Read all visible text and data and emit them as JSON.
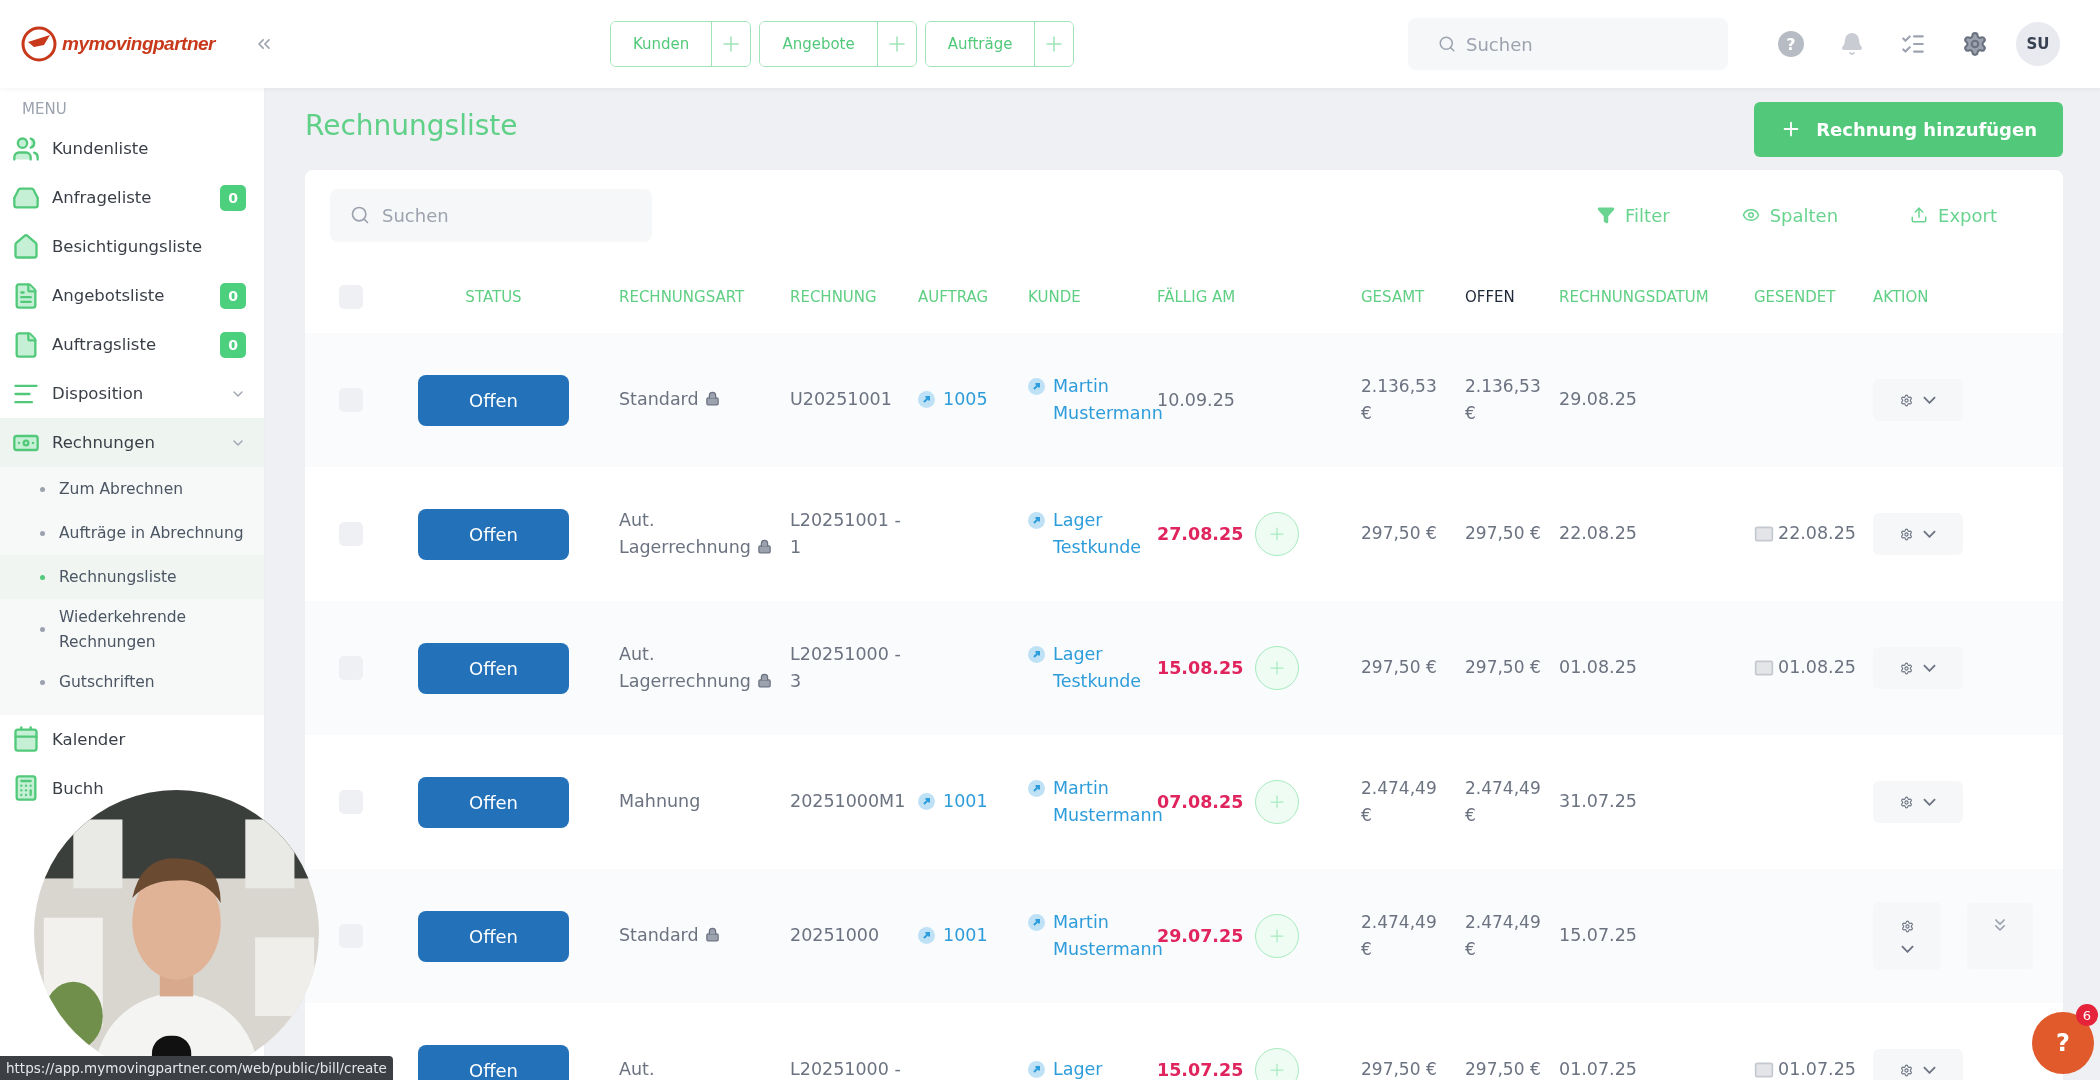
{
  "header": {
    "logo": "mymovingpartner",
    "quick_actions": [
      {
        "label": "Kunden"
      },
      {
        "label": "Angebote"
      },
      {
        "label": "Aufträge"
      }
    ],
    "search": {
      "placeholder": "Suchen"
    },
    "help": "?",
    "avatar": "SU"
  },
  "sidebar": {
    "heading": "MENU",
    "items": [
      {
        "label": "Kundenliste"
      },
      {
        "label": "Anfrageliste",
        "badge": "0"
      },
      {
        "label": "Besichtigungsliste"
      },
      {
        "label": "Angebotsliste",
        "badge": "0"
      },
      {
        "label": "Auftragsliste",
        "badge": "0"
      },
      {
        "label": "Disposition",
        "expanded": false
      },
      {
        "label": "Rechnungen",
        "expanded": true,
        "children": [
          {
            "label": "Zum Abrechnen",
            "selected": false
          },
          {
            "label": "Aufträge in Abrechnung",
            "selected": false
          },
          {
            "label": "Rechnungsliste",
            "selected": true
          },
          {
            "label": "Wiederkehrende Rechnungen",
            "selected": false
          },
          {
            "label": "Gutschriften",
            "selected": false
          }
        ]
      },
      {
        "label": "Kalender"
      },
      {
        "label": "Buchh"
      }
    ]
  },
  "page": {
    "title": "Rechnungsliste",
    "add_button": "Rechnung hinzufügen"
  },
  "toolbar": {
    "search": {
      "placeholder": "Suchen"
    },
    "actions": [
      {
        "label": "Filter"
      },
      {
        "label": "Spalten"
      },
      {
        "label": "Export"
      }
    ]
  },
  "table": {
    "header_checked": false,
    "columns": [
      {
        "label": "STATUS",
        "sorted": false
      },
      {
        "label": "RECHNUNGSART",
        "sorted": false
      },
      {
        "label": "RECHNUNG",
        "sorted": false
      },
      {
        "label": "AUFTRAG",
        "sorted": false
      },
      {
        "label": "KUNDE",
        "sorted": false
      },
      {
        "label": "FÄLLIG AM",
        "sorted": false
      },
      {
        "label": "GESAMT",
        "sorted": false
      },
      {
        "label": "OFFEN",
        "sorted": true
      },
      {
        "label": "RECHNUNGSDATUM",
        "sorted": false
      },
      {
        "label": "GESENDET",
        "sorted": false
      },
      {
        "label": "AKTION",
        "sorted": false
      }
    ],
    "rows": [
      {
        "checked": false,
        "status": "Offen",
        "type": "Standard",
        "locked": true,
        "number": "U20251001",
        "order": "1005",
        "customer": "Martin Mustermann",
        "due": "10.09.25",
        "overdue": false,
        "total": "2.136,53 €",
        "open": "2.136,53 €",
        "date": "29.08.25",
        "expand_button": false
      },
      {
        "checked": false,
        "status": "Offen",
        "type": "Aut. Lagerrechnung",
        "locked": true,
        "number": "L20251001 - 1",
        "customer": "Lager Testkunde",
        "due": "27.08.25",
        "overdue": true,
        "total": "297,50 €",
        "open": "297,50 €",
        "date": "22.08.25",
        "sent": "22.08.25",
        "expand_button": false
      },
      {
        "checked": false,
        "status": "Offen",
        "type": "Aut. Lagerrechnung",
        "locked": true,
        "number": "L20251000 - 3",
        "customer": "Lager Testkunde",
        "due": "15.08.25",
        "overdue": true,
        "total": "297,50 €",
        "open": "297,50 €",
        "date": "01.08.25",
        "sent": "01.08.25",
        "expand_button": false
      },
      {
        "checked": false,
        "status": "Offen",
        "type": "Mahnung",
        "locked": false,
        "number": "20251000M1",
        "order": "1001",
        "customer": "Martin Mustermann",
        "due": "07.08.25",
        "overdue": true,
        "total": "2.474,49 €",
        "open": "2.474,49 €",
        "date": "31.07.25",
        "expand_button": false
      },
      {
        "checked": false,
        "status": "Offen",
        "type": "Standard",
        "locked": true,
        "number": "20251000",
        "order": "1001",
        "customer": "Martin Mustermann",
        "due": "29.07.25",
        "overdue": true,
        "total": "2.474,49 €",
        "open": "2.474,49 €",
        "date": "15.07.25",
        "expand_button": true
      },
      {
        "status": "Offen",
        "type": "Aut.",
        "number": "L20251000 -",
        "customer": "Lager",
        "due": "15.07.25",
        "overdue": true,
        "total": "297,50 €",
        "open": "297,50 €",
        "date": "01.07.25",
        "sent": "01.07.25",
        "expand_button": false
      }
    ]
  },
  "status_url": "https://app.mymovingpartner.com/web/public/bill/create",
  "help_bubble": {
    "label": "?",
    "count": "6"
  }
}
